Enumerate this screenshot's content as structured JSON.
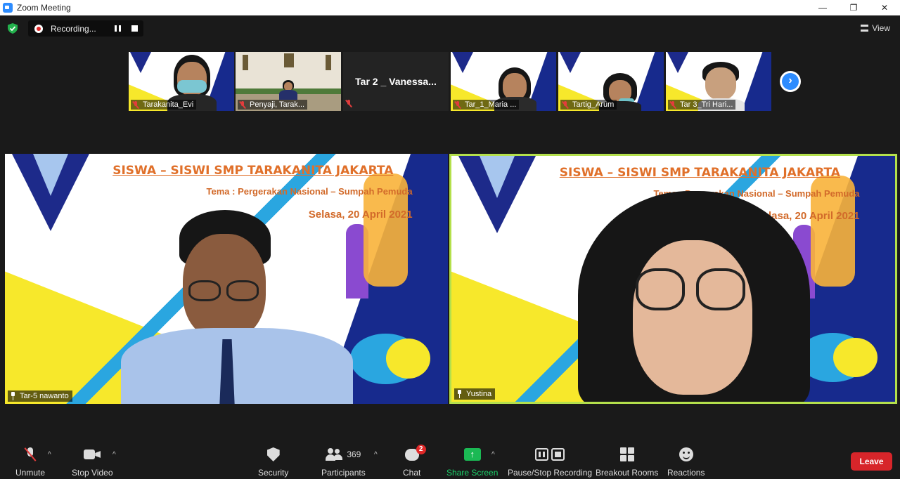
{
  "window": {
    "title": "Zoom Meeting",
    "minimize": "—",
    "restore": "❐",
    "close": "✕"
  },
  "status": {
    "recording": "Recording...",
    "view": "View"
  },
  "thumbnails": [
    {
      "name": "Tarakanita_Evi"
    },
    {
      "name": "Penyaji, Tarak..."
    },
    {
      "name": "Tar 2 _ Vanessa..."
    },
    {
      "name": "Tar_1_Maria ..."
    },
    {
      "name": "Tartig_Arum"
    },
    {
      "name": "Tar 3_Tri Hari..."
    }
  ],
  "slide": {
    "title": "SISWA – SISWI SMP TARAKANITA JAKARTA",
    "theme": "Tema : Pergerakan Nasional – Sumpah Pemuda",
    "date": "Selasa, 20 April 2021"
  },
  "main_tiles": [
    {
      "name": "Tar-5 nawanto"
    },
    {
      "name": "Yustina"
    }
  ],
  "toolbar": {
    "unmute": "Unmute",
    "stop_video": "Stop Video",
    "security": "Security",
    "participants": "Participants",
    "participants_count": "369",
    "chat": "Chat",
    "chat_badge": "2",
    "share_screen": "Share Screen",
    "pause_stop_recording": "Pause/Stop Recording",
    "breakout_rooms": "Breakout Rooms",
    "reactions": "Reactions",
    "leave": "Leave"
  },
  "colors": {
    "accent": "#2d8cff",
    "share": "#1bb954",
    "leave": "#d7252a",
    "active_speaker": "#b4e04c"
  }
}
